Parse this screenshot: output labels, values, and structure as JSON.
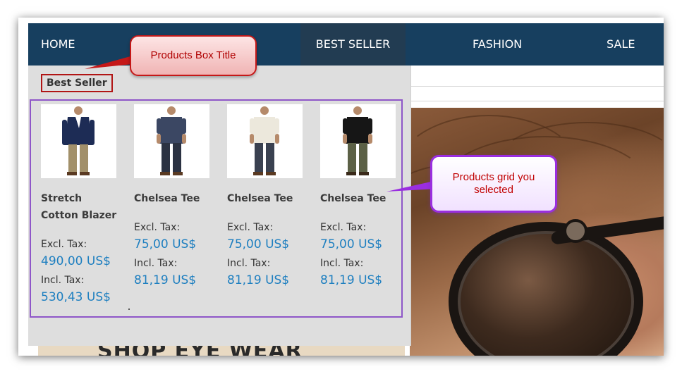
{
  "nav": {
    "items": [
      {
        "label": "HOME"
      },
      {
        "label": "BEST SELLER",
        "active": true
      },
      {
        "label": "FASHION"
      },
      {
        "label": "SALE"
      }
    ]
  },
  "dropdown": {
    "title": "Best Seller",
    "products": [
      {
        "name_line1": "Stretch",
        "name_line2": "Cotton Blazer",
        "excl_label": "Excl. Tax:",
        "excl_price": "490,00 US$",
        "incl_label": "Incl. Tax:",
        "incl_price": "530,43 US$"
      },
      {
        "name_line1": "Chelsea Tee",
        "name_line2": "",
        "excl_label": "Excl. Tax:",
        "excl_price": "75,00 US$",
        "incl_label": "Incl. Tax:",
        "incl_price": "81,19 US$"
      },
      {
        "name_line1": "Chelsea Tee",
        "name_line2": "",
        "excl_label": "Excl. Tax:",
        "excl_price": "75,00 US$",
        "incl_label": "Incl. Tax:",
        "incl_price": "81,19 US$"
      },
      {
        "name_line1": "Chelsea Tee",
        "name_line2": "",
        "excl_label": "Excl. Tax:",
        "excl_price": "75,00 US$",
        "incl_label": "Incl. Tax:",
        "incl_price": "81,19 US$"
      }
    ]
  },
  "annotations": {
    "title_callout": "Products Box Title",
    "grid_callout": "Products grid you selected"
  },
  "banner": {
    "text": "SHOP EYE WEAR"
  },
  "colors": {
    "nav_bg": "#173f5f",
    "price": "#1e7fc0",
    "title_box_border": "#b11515",
    "grid_border": "#8e56c8"
  }
}
